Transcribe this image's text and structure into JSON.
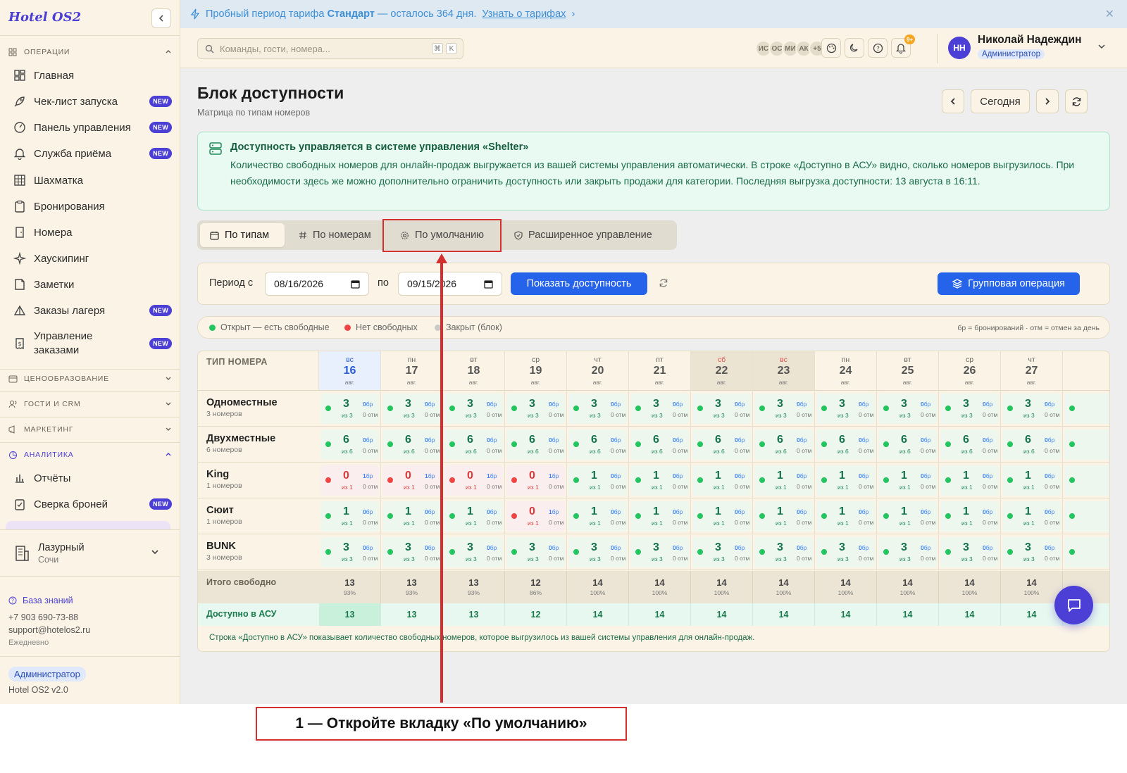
{
  "sidebar": {
    "logo": "Hotel OS2",
    "sections": {
      "operations": "ОПЕРАЦИИ",
      "pricing": "ЦЕНООБРАЗОВАНИЕ",
      "guests": "ГОСТИ И CRM",
      "marketing": "МАРКЕТИНГ",
      "analytics": "АНАЛИТИКА"
    },
    "items": [
      {
        "label": "Главная",
        "icon": "dashboard-icon",
        "new": false
      },
      {
        "label": "Чек-лист запуска",
        "icon": "rocket-icon",
        "new": true
      },
      {
        "label": "Панель управления",
        "icon": "gauge-icon",
        "new": true
      },
      {
        "label": "Служба приёма",
        "icon": "bell-icon",
        "new": true
      },
      {
        "label": "Шахматка",
        "icon": "grid-icon",
        "new": false
      },
      {
        "label": "Бронирования",
        "icon": "clipboard-icon",
        "new": false
      },
      {
        "label": "Номера",
        "icon": "door-icon",
        "new": false
      },
      {
        "label": "Хаускипинг",
        "icon": "sparkle-icon",
        "new": false
      },
      {
        "label": "Заметки",
        "icon": "note-icon",
        "new": false
      },
      {
        "label": "Заказы лагеря",
        "icon": "tent-icon",
        "new": true
      },
      {
        "label": "Управление заказами",
        "icon": "receipt-icon",
        "new": true
      }
    ],
    "analytics_items": [
      {
        "label": "Отчёты",
        "icon": "bar-chart-icon",
        "new": false
      },
      {
        "label": "Сверка броней",
        "icon": "clipboard-check-icon",
        "new": true
      }
    ],
    "new_badge": "NEW",
    "hotel": {
      "name": "Лазурный",
      "city": "Сочи"
    },
    "knowledge_base": "База знаний",
    "phone": "+7 903 690-73-88",
    "email": "support@hotelos2.ru",
    "schedule": "Ежедневно",
    "role": "Администратор",
    "version": "Hotel OS2 v2.0"
  },
  "banner": {
    "prefix": "Пробный период тарифа",
    "plan": "Стандарт",
    "suffix": "— осталось 364 дня.",
    "link": "Узнать о тарифах",
    "close": "✕"
  },
  "header": {
    "search_placeholder": "Команды, гости, номера...",
    "kbd1": "⌘",
    "kbd2": "K",
    "avatars": [
      "ИС",
      "ОС",
      "МИ",
      "АК",
      "+5"
    ],
    "notif_count": "9+",
    "user_initials": "НН",
    "user_name": "Николай Надеждин",
    "user_role": "Администратор"
  },
  "page": {
    "title": "Блок доступности",
    "subtitle": "Матрица по типам номеров",
    "today_btn": "Сегодня"
  },
  "alert": {
    "title": "Доступность управляется в системе управления «Shelter»",
    "body": "Количество свободных номеров для онлайн-продаж выгружается из вашей системы управления автоматически. В строке «Доступно в АСУ» видно, сколько номеров выгрузилось. При необходимости здесь же можно дополнительно ограничить доступность или закрыть продажи для категории. Последняя выгрузка доступности: 13 августа в 16:11."
  },
  "tabs": [
    {
      "label": "По типам",
      "icon": "calendar-icon",
      "active": true
    },
    {
      "label": "По номерам",
      "icon": "hash-icon",
      "active": false
    },
    {
      "label": "По умолчанию",
      "icon": "gear-icon",
      "active": false
    },
    {
      "label": "Расширенное управление",
      "icon": "shield-icon",
      "active": false
    }
  ],
  "filter": {
    "period_from": "Период с",
    "date_from": "08/16/2026",
    "to": "по",
    "date_to": "09/15/2026",
    "show_btn": "Показать доступность",
    "group_btn": "Групповая операция"
  },
  "legend": {
    "open": "Открыт — есть свободные",
    "none": "Нет свободных",
    "closed": "Закрыт (блок)",
    "note": "бр = бронирований · отм = отмен за день",
    "colors": {
      "open": "#22c55e",
      "none": "#ef4444",
      "closed": "#c9c9c9"
    }
  },
  "table": {
    "type_header": "ТИП НОМЕРА",
    "days": [
      {
        "dow": "вс",
        "day": "16",
        "mon": "авг."
      },
      {
        "dow": "пн",
        "day": "17",
        "mon": "авг."
      },
      {
        "dow": "вт",
        "day": "18",
        "mon": "авг."
      },
      {
        "dow": "ср",
        "day": "19",
        "mon": "авг."
      },
      {
        "dow": "чт",
        "day": "20",
        "mon": "авг."
      },
      {
        "dow": "пт",
        "day": "21",
        "mon": "авг."
      },
      {
        "dow": "сб",
        "day": "22",
        "mon": "авг."
      },
      {
        "dow": "вс",
        "day": "23",
        "mon": "авг."
      },
      {
        "dow": "пн",
        "day": "24",
        "mon": "авг."
      },
      {
        "dow": "вт",
        "day": "25",
        "mon": "авг."
      },
      {
        "dow": "ср",
        "day": "26",
        "mon": "авг."
      },
      {
        "dow": "чт",
        "day": "27",
        "mon": "авг."
      }
    ],
    "rows": [
      {
        "name": "Одноместные",
        "count": "3 номеров",
        "of": "из 3",
        "free": [
          3,
          3,
          3,
          3,
          3,
          3,
          3,
          3,
          3,
          3,
          3,
          3
        ],
        "br": [
          0,
          0,
          0,
          0,
          0,
          0,
          0,
          0,
          0,
          0,
          0,
          0
        ]
      },
      {
        "name": "Двухместные",
        "count": "6 номеров",
        "of": "из 6",
        "free": [
          6,
          6,
          6,
          6,
          6,
          6,
          6,
          6,
          6,
          6,
          6,
          6
        ],
        "br": [
          0,
          0,
          0,
          0,
          0,
          0,
          0,
          0,
          0,
          0,
          0,
          0
        ]
      },
      {
        "name": "King",
        "count": "1 номеров",
        "of": "из 1",
        "free": [
          0,
          0,
          0,
          0,
          1,
          1,
          1,
          1,
          1,
          1,
          1,
          1
        ],
        "br": [
          1,
          1,
          1,
          1,
          0,
          0,
          0,
          0,
          0,
          0,
          0,
          0
        ]
      },
      {
        "name": "Сюит",
        "count": "1 номеров",
        "of": "из 1",
        "free": [
          1,
          1,
          1,
          0,
          1,
          1,
          1,
          1,
          1,
          1,
          1,
          1
        ],
        "br": [
          0,
          0,
          0,
          1,
          0,
          0,
          0,
          0,
          0,
          0,
          0,
          0
        ]
      },
      {
        "name": "BUNK",
        "count": "3 номеров",
        "of": "из 3",
        "free": [
          3,
          3,
          3,
          3,
          3,
          3,
          3,
          3,
          3,
          3,
          3,
          3
        ],
        "br": [
          0,
          0,
          0,
          0,
          0,
          0,
          0,
          0,
          0,
          0,
          0,
          0
        ]
      }
    ],
    "br_suffix": "бр",
    "otm": "0 отм",
    "total_label": "Итого свободно",
    "totals": [
      {
        "v": "13",
        "p": "93%"
      },
      {
        "v": "13",
        "p": "93%"
      },
      {
        "v": "13",
        "p": "93%"
      },
      {
        "v": "12",
        "p": "86%"
      },
      {
        "v": "14",
        "p": "100%"
      },
      {
        "v": "14",
        "p": "100%"
      },
      {
        "v": "14",
        "p": "100%"
      },
      {
        "v": "14",
        "p": "100%"
      },
      {
        "v": "14",
        "p": "100%"
      },
      {
        "v": "14",
        "p": "100%"
      },
      {
        "v": "14",
        "p": "100%"
      },
      {
        "v": "14",
        "p": "100%"
      }
    ],
    "asu_label": "Доступно в АСУ",
    "asu": [
      "13",
      "13",
      "13",
      "12",
      "14",
      "14",
      "14",
      "14",
      "14",
      "14",
      "14",
      "14"
    ],
    "note": "Строка «Доступно в АСУ» показывает количество свободных номеров, которое выгрузилось из вашей системы управления для онлайн-продаж."
  },
  "annotation": {
    "caption": "1 — Откройте вкладку «По умолчанию»",
    "color": "#d32f2f"
  }
}
